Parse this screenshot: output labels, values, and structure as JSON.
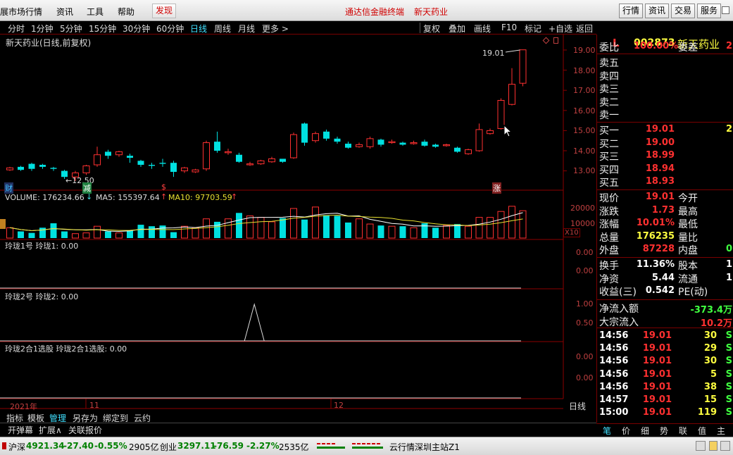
{
  "topbar": {
    "menus": [
      "展市场行情",
      "资讯",
      "工具",
      "帮助"
    ],
    "discover": "发现",
    "title_app": "通达信金融终端",
    "title_stock": "新天药业",
    "buttons": [
      "行情",
      "资讯",
      "交易",
      "服务"
    ]
  },
  "periods": [
    "分时",
    "1分钟",
    "5分钟",
    "15分钟",
    "30分钟",
    "60分钟",
    "日线",
    "周线",
    "月线",
    "更多 >"
  ],
  "active_period": "日线",
  "right_tools": [
    "复权",
    "叠加",
    "画线",
    "F10",
    "标记",
    "+自选",
    "返回"
  ],
  "chart": {
    "title": "新天药业(日线,前复权)",
    "high_label": "19.01",
    "low_label": "←12.50",
    "markers": {
      "cai": "财",
      "jian": "减",
      "s": "$",
      "zhang": "涨"
    },
    "price_axis": [
      "19.00",
      "18.00",
      "17.00",
      "16.00",
      "15.00",
      "14.00",
      "13.00"
    ],
    "volume_label": "VOLUME: 176234.66",
    "ma5_label": "MA5: 155397.64",
    "ma10_label": "MA10: 97703.59",
    "vol_axis": [
      "20000",
      "10000"
    ],
    "vol_unit": "X10",
    "ind1_title": "玲珑1号  玲珑1: 0.00",
    "ind1_axis": [
      "0.00",
      "0.00"
    ],
    "ind2_title": "玲珑2号  玲珑2: 0.00",
    "ind2_axis": [
      "1.00",
      "0.50"
    ],
    "ind3_title": "玲珑2合1选股  玲珑2合1选股: 0.00",
    "ind3_axis": [
      "0.00",
      "0.00"
    ],
    "date_labels": [
      "2021年",
      "11",
      "12"
    ],
    "period_tag": "日线",
    "zoom_buttons": [
      "+",
      "-",
      "○"
    ],
    "colors": {
      "up": "#ff3030",
      "down": "#00e0e0",
      "ma5": "#ffffff",
      "ma10": "#e8e030",
      "frame": "#8b0000"
    }
  },
  "chart_data": {
    "type": "candlestick",
    "ohlc": [
      [
        13.05,
        13.15,
        13.0,
        13.2
      ],
      [
        13.2,
        13.05,
        13.0,
        13.25
      ],
      [
        13.35,
        13.1,
        13.0,
        13.4
      ],
      [
        13.3,
        13.2,
        13.1,
        13.35
      ],
      [
        13.15,
        13.1,
        13.0,
        13.2
      ],
      [
        13.0,
        12.7,
        12.6,
        13.05
      ],
      [
        12.7,
        12.9,
        12.5,
        13.0
      ],
      [
        12.9,
        13.25,
        12.8,
        13.3
      ],
      [
        13.3,
        13.8,
        13.2,
        14.2
      ],
      [
        13.95,
        13.75,
        13.6,
        14.05
      ],
      [
        13.8,
        13.95,
        13.7,
        14.0
      ],
      [
        13.75,
        13.65,
        13.4,
        13.85
      ],
      [
        13.5,
        13.3,
        13.2,
        13.55
      ],
      [
        13.3,
        13.25,
        13.1,
        13.4
      ],
      [
        13.4,
        13.35,
        13.2,
        13.6
      ],
      [
        13.4,
        12.95,
        12.7,
        13.5
      ],
      [
        13.0,
        13.15,
        12.9,
        13.2
      ],
      [
        12.95,
        13.05,
        12.9,
        13.1
      ],
      [
        13.1,
        14.4,
        13.0,
        14.5
      ],
      [
        14.45,
        14.0,
        13.9,
        14.95
      ],
      [
        13.9,
        13.95,
        13.8,
        14.1
      ],
      [
        13.8,
        13.45,
        13.4,
        13.9
      ],
      [
        13.3,
        13.35,
        13.25,
        13.45
      ],
      [
        13.35,
        13.5,
        13.3,
        13.55
      ],
      [
        13.45,
        13.6,
        13.4,
        13.7
      ],
      [
        13.6,
        13.45,
        13.4,
        13.6
      ],
      [
        13.65,
        14.8,
        13.6,
        14.9
      ],
      [
        15.35,
        14.4,
        14.25,
        15.4
      ],
      [
        14.5,
        14.85,
        14.4,
        14.95
      ],
      [
        14.95,
        14.6,
        14.5,
        15.05
      ],
      [
        14.6,
        14.45,
        14.35,
        14.7
      ],
      [
        14.35,
        14.15,
        14.1,
        14.45
      ],
      [
        14.2,
        14.3,
        14.15,
        14.4
      ],
      [
        14.2,
        14.6,
        14.1,
        14.7
      ],
      [
        14.55,
        14.3,
        14.2,
        14.6
      ],
      [
        14.4,
        14.45,
        14.35,
        14.55
      ],
      [
        14.4,
        14.3,
        14.25,
        14.45
      ],
      [
        14.35,
        14.4,
        14.3,
        14.5
      ],
      [
        14.45,
        14.25,
        14.2,
        14.55
      ],
      [
        14.3,
        14.2,
        14.15,
        14.35
      ],
      [
        14.25,
        14.3,
        14.2,
        14.35
      ],
      [
        14.15,
        13.95,
        13.9,
        14.2
      ],
      [
        13.85,
        14.05,
        13.8,
        14.1
      ],
      [
        14.0,
        15.05,
        13.95,
        15.35
      ],
      [
        14.85,
        15.0,
        14.8,
        15.1
      ],
      [
        15.1,
        16.5,
        15.05,
        16.6
      ],
      [
        16.3,
        17.3,
        16.25,
        18.1
      ],
      [
        17.35,
        19.01,
        17.2,
        19.01
      ]
    ],
    "volume": [
      700,
      450,
      350,
      700,
      1000,
      450,
      300,
      350,
      800,
      450,
      350,
      500,
      900,
      800,
      850,
      400,
      800,
      700,
      1300,
      1100,
      1300,
      1700,
      1500,
      1400,
      1100,
      1350,
      2000,
      1250,
      2100,
      1550,
      1500,
      1050,
      1300,
      950,
      850,
      800,
      800,
      700,
      1000,
      700,
      850,
      950,
      800,
      1400,
      1400,
      1800,
      2150,
      1850
    ],
    "ind2_peak_index": 28,
    "xlabel": "",
    "ylabel": ""
  },
  "right_panel": {
    "code_prefix": "L",
    "code": "002873",
    "name": "新天药业",
    "weibi_label": "委比",
    "weibi_value": "100.00%",
    "weicha_label": "委差",
    "weicha_value": "2",
    "sells": [
      {
        "label": "卖五",
        "price": "",
        "vol": ""
      },
      {
        "label": "卖四",
        "price": "",
        "vol": ""
      },
      {
        "label": "卖三",
        "price": "",
        "vol": ""
      },
      {
        "label": "卖二",
        "price": "",
        "vol": ""
      },
      {
        "label": "卖一",
        "price": "",
        "vol": ""
      }
    ],
    "buys": [
      {
        "label": "买一",
        "price": "19.01",
        "vol": "2"
      },
      {
        "label": "买二",
        "price": "19.00",
        "vol": ""
      },
      {
        "label": "买三",
        "price": "18.99",
        "vol": ""
      },
      {
        "label": "买四",
        "price": "18.94",
        "vol": ""
      },
      {
        "label": "买五",
        "price": "18.93",
        "vol": ""
      }
    ],
    "stats": [
      {
        "l1": "现价",
        "v1": "19.01",
        "c1": "#ff3030",
        "l2": "今开",
        "v2": ""
      },
      {
        "l1": "涨跌",
        "v1": "1.73",
        "c1": "#ff3030",
        "l2": "最高",
        "v2": ""
      },
      {
        "l1": "涨幅",
        "v1": "10.01%",
        "c1": "#ff3030",
        "l2": "最低",
        "v2": ""
      },
      {
        "l1": "总量",
        "v1": "176235",
        "c1": "#ffff40",
        "l2": "量比",
        "v2": ""
      },
      {
        "l1": "外盘",
        "v1": "87228",
        "c1": "#ff3030",
        "l2": "内盘",
        "v2": "0"
      }
    ],
    "stats2": [
      {
        "l1": "换手",
        "v1": "11.36%",
        "c1": "#ffffff",
        "l2": "股本",
        "v2": "1"
      },
      {
        "l1": "净资",
        "v1": "5.44",
        "c1": "#ffffff",
        "l2": "流通",
        "v2": "1"
      },
      {
        "l1": "收益(三)",
        "v1": "0.542",
        "c1": "#ffffff",
        "l2": "PE(动)",
        "v2": ""
      }
    ],
    "flow": [
      {
        "label": "净流入额",
        "value": "-373.4万",
        "color": "#40ff40"
      },
      {
        "label": "大宗流入",
        "value": "10.2万",
        "color": "#ff3030"
      }
    ],
    "ticks": [
      {
        "t": "14:56",
        "p": "19.01",
        "v": "30",
        "d": "S"
      },
      {
        "t": "14:56",
        "p": "19.01",
        "v": "29",
        "d": "S"
      },
      {
        "t": "14:56",
        "p": "19.01",
        "v": "30",
        "d": "S"
      },
      {
        "t": "14:56",
        "p": "19.01",
        "v": "5",
        "d": "S"
      },
      {
        "t": "14:56",
        "p": "19.01",
        "v": "38",
        "d": "S"
      },
      {
        "t": "14:57",
        "p": "19.01",
        "v": "15",
        "d": "S"
      },
      {
        "t": "15:00",
        "p": "19.01",
        "v": "119",
        "d": "S"
      }
    ],
    "tabs": [
      "笔",
      "价",
      "细",
      "势",
      "联",
      "值",
      "主"
    ]
  },
  "bottom_tabs": [
    "指标",
    "模板",
    "管理",
    "另存为",
    "绑定到",
    "云约"
  ],
  "bottom_tabs2": [
    "开弹幕",
    "扩展∧",
    "关联报价"
  ],
  "status": {
    "hs_label": "沪深",
    "hs_value": "4921.34",
    "hs_change": "-27.40",
    "hs_pct": "-0.55%",
    "hs_amount": "2905亿",
    "cy_label": "创业",
    "cy_value": "3297.11",
    "cy_change": "-76.59",
    "cy_pct": "-2.27%",
    "cy_amount": "2535亿",
    "server": "云行情深圳主站Z1"
  }
}
